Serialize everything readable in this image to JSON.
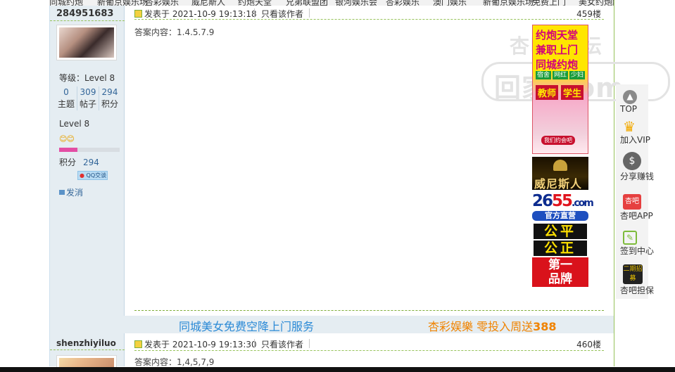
{
  "nav": {
    "items": [
      "同城约炮",
      "新葡京娱乐场",
      "杏彩娱乐",
      "威尼斯人",
      "约炮天堂",
      "兄弟联盟团",
      "银河娱乐会",
      "杏彩娱乐",
      "澳门娱乐",
      "新葡京娱乐场",
      "免费上门",
      "美女约炮献入"
    ]
  },
  "post1": {
    "username": "284951683",
    "level": "等级：Level 8",
    "stats": [
      {
        "value": "0",
        "label": "主题"
      },
      {
        "value": "309",
        "label": "帖子"
      },
      {
        "value": "294",
        "label": "积分"
      }
    ],
    "group": "Level 8",
    "progress": 0.3,
    "credit_label": "积分",
    "credit_value": "294",
    "qq_badge": "QQ交谈",
    "send_message": "发消",
    "posted_at": "发表于 2021-10-9 19:13:18",
    "only_author": "只看该作者",
    "floor": "459楼",
    "content": "答案内容：1.4.5.7.9"
  },
  "promo": {
    "left": "同城美女免费空降上门服务",
    "right_prefix": "杏彩娱樂 零投入周送",
    "right_amount": "388"
  },
  "post2": {
    "username": "shenzhiyiluo",
    "posted_at": "发表于 2021-10-9 19:13:30",
    "only_author": "只看该作者",
    "floor": "460楼",
    "content": "答案内容：1,4,5,7,9"
  },
  "watermark": {
    "top": "杏吧·论坛",
    "bottom": "回家.com"
  },
  "ads": {
    "tall_lines": [
      "约炮天堂",
      "兼职上门",
      "同城约炮"
    ],
    "tall_tags": [
      "宿舍",
      "网红",
      "少妇"
    ],
    "tall_tags2": [
      "教师",
      "学生"
    ],
    "tall_bottom": "我们约会吧",
    "venetian": "威尼斯人",
    "num_blue": "26",
    "num_red": "55",
    "num_com": ".com",
    "official": "官方直营",
    "fair1": "公平",
    "fair2": "公正",
    "brand_line1": "第一",
    "brand_line2": "品牌"
  },
  "tools": {
    "top": "TOP",
    "vip": "加入VIP",
    "share": "分享赚钱",
    "app": "杏吧APP",
    "sign": "签到中心",
    "ensure": "杏吧担保",
    "ensure_icon_text": "二期招募",
    "app_icon_text": "杏吧"
  },
  "colors": {
    "sidebar_bg": "#e5edf2",
    "link_blue": "#336699",
    "accent_green": "#96c25a",
    "promo_blue": "#2b8ad6",
    "promo_orange": "#f08300"
  }
}
